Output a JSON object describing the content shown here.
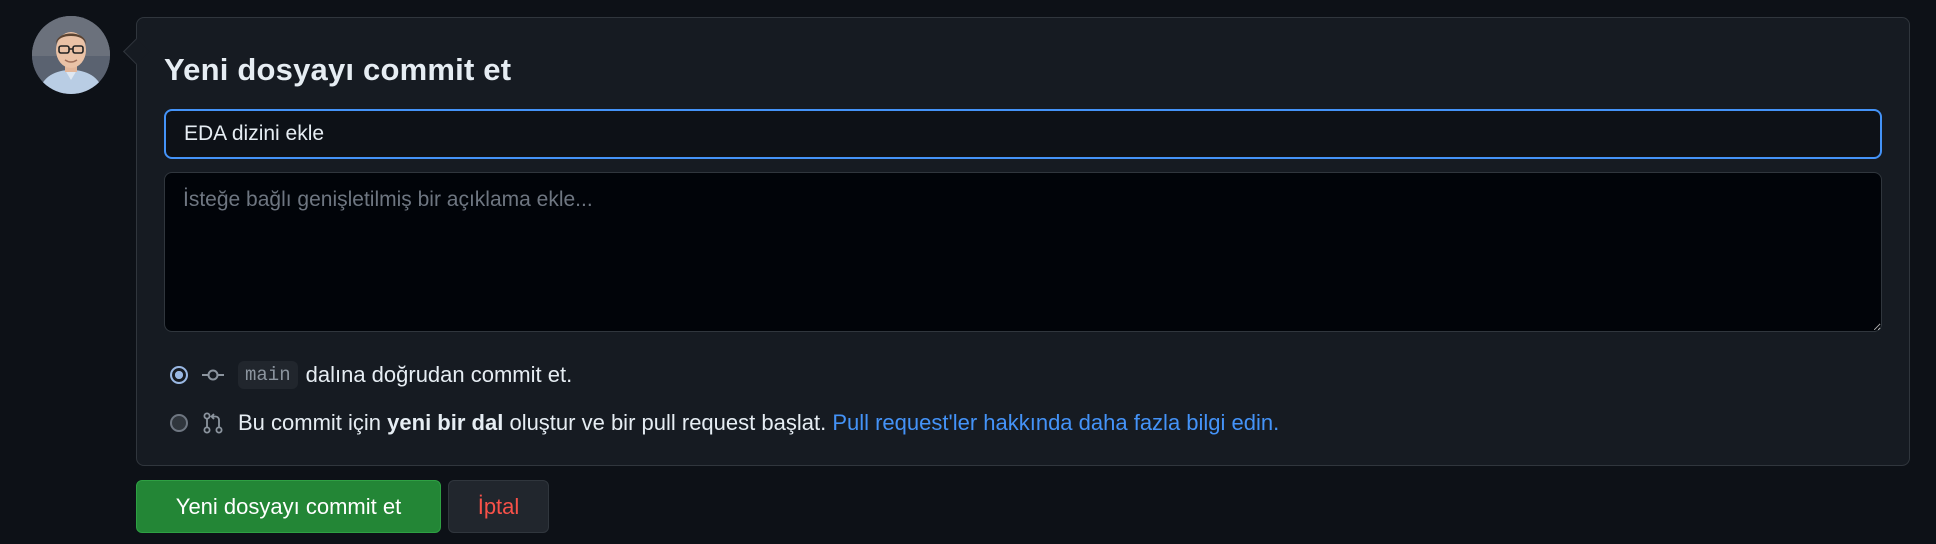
{
  "form": {
    "title": "Yeni dosyayı commit et",
    "summary_value": "EDA dizini ekle",
    "description_placeholder": "İsteğe bağlı genişletilmiş bir açıklama ekle..."
  },
  "options": {
    "direct": {
      "branch": "main",
      "text": "dalına doğrudan commit et.",
      "icon": "git-commit-icon",
      "selected": true
    },
    "new_branch": {
      "text_before": "Bu commit için",
      "text_strong": "yeni bir dal",
      "text_after": "oluştur ve bir pull request başlat.",
      "link": "Pull request'ler hakkında daha fazla bilgi edin.",
      "icon": "git-pull-request-icon",
      "selected": false
    }
  },
  "actions": {
    "commit_label": "Yeni dosyayı commit et",
    "cancel_label": "İptal"
  },
  "colors": {
    "background": "#0d1117",
    "accent": "#4493f8",
    "commit_button": "#238636",
    "cancel_text": "#f85149"
  }
}
